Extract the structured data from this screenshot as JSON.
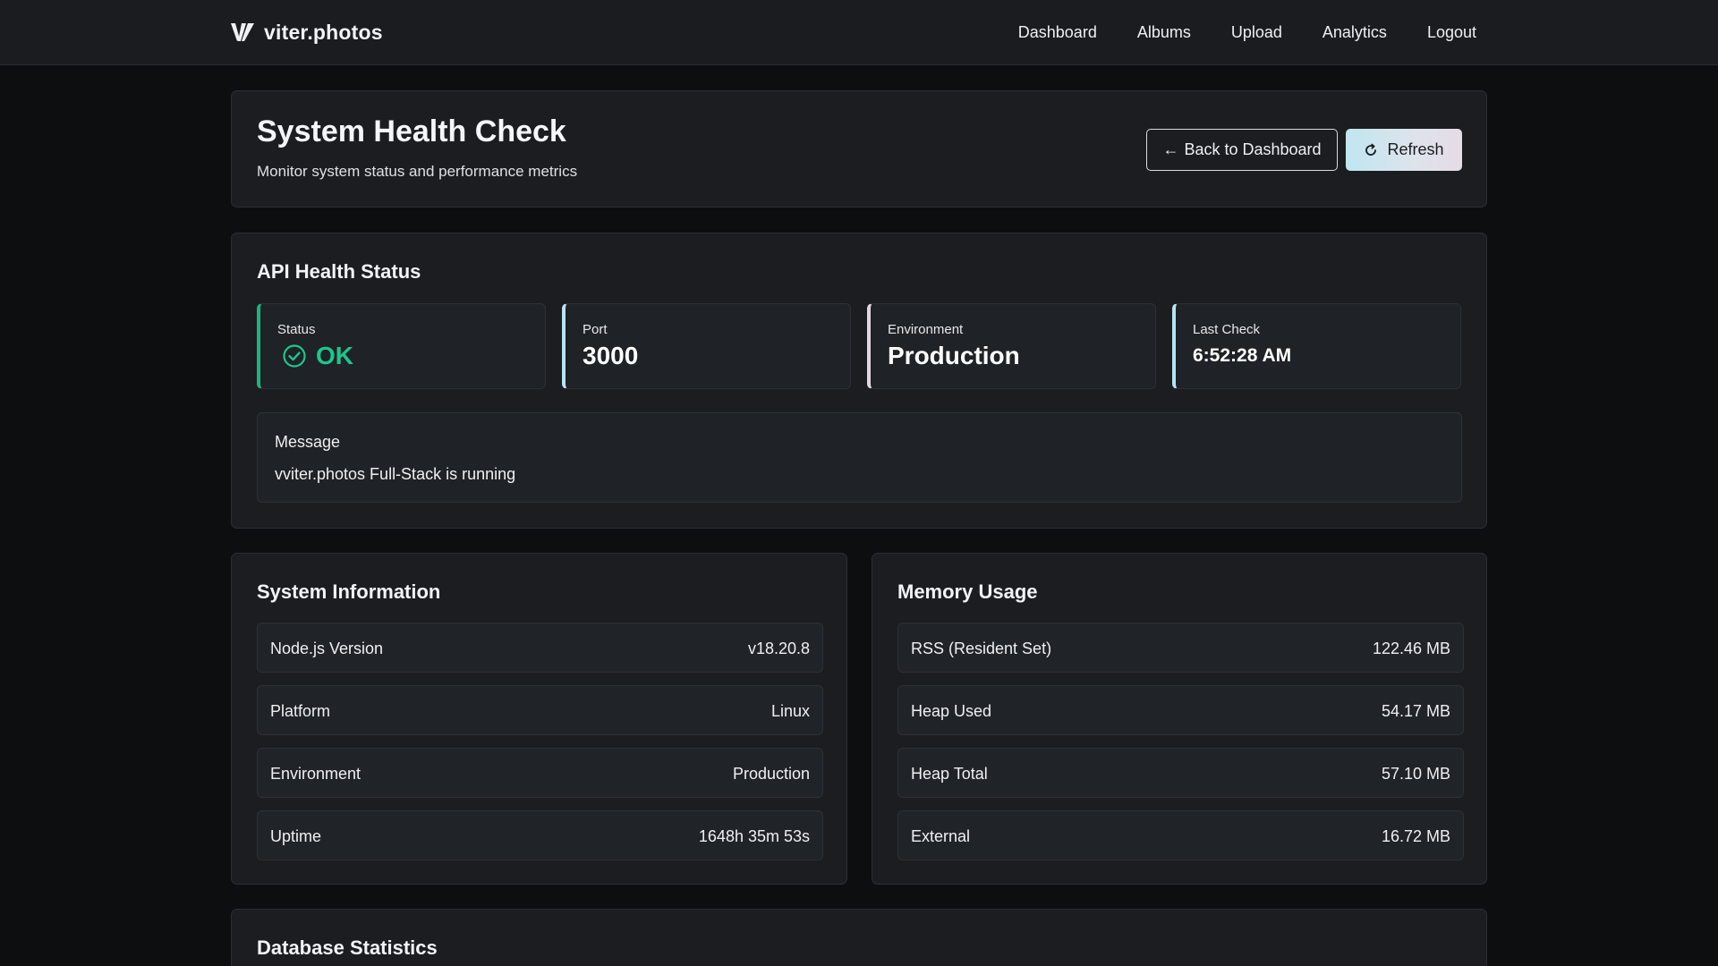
{
  "nav": {
    "brand": "viter.photos",
    "links": [
      "Dashboard",
      "Albums",
      "Upload",
      "Analytics",
      "Logout"
    ]
  },
  "header": {
    "title": "System Health Check",
    "subtitle": "Monitor system status and performance metrics",
    "back_label": "Back to Dashboard",
    "back_arrow": "←",
    "refresh_label": "Refresh"
  },
  "api": {
    "title": "API Health Status",
    "status_label": "Status",
    "status_value": "OK",
    "port_label": "Port",
    "port_value": "3000",
    "env_label": "Environment",
    "env_value": "Production",
    "last_label": "Last Check",
    "last_value": "6:52:28 AM",
    "message_label": "Message",
    "message_text": "vviter.photos Full-Stack is running"
  },
  "system": {
    "title": "System Information",
    "rows": [
      {
        "key": "Node.js Version",
        "value": "v18.20.8"
      },
      {
        "key": "Platform",
        "value": "Linux"
      },
      {
        "key": "Environment",
        "value": "Production"
      },
      {
        "key": "Uptime",
        "value": "1648h 35m 53s"
      }
    ]
  },
  "memory": {
    "title": "Memory Usage",
    "rows": [
      {
        "key": "RSS (Resident Set)",
        "value": "122.46 MB"
      },
      {
        "key": "Heap Used",
        "value": "54.17 MB"
      },
      {
        "key": "Heap Total",
        "value": "57.10 MB"
      },
      {
        "key": "External",
        "value": "16.72 MB"
      }
    ]
  },
  "database": {
    "title": "Database Statistics"
  },
  "colors": {
    "background": "#0d0e10",
    "card": "#1b1d21",
    "status_ok": "#1fc58a",
    "accent_cyan": "#b6e4ef",
    "accent_pink": "#e4d6e0"
  },
  "icons": {
    "brand": "brand-logo-icon",
    "back": "arrow-left-icon",
    "refresh": "refresh-icon",
    "status": "check-circle-icon"
  }
}
